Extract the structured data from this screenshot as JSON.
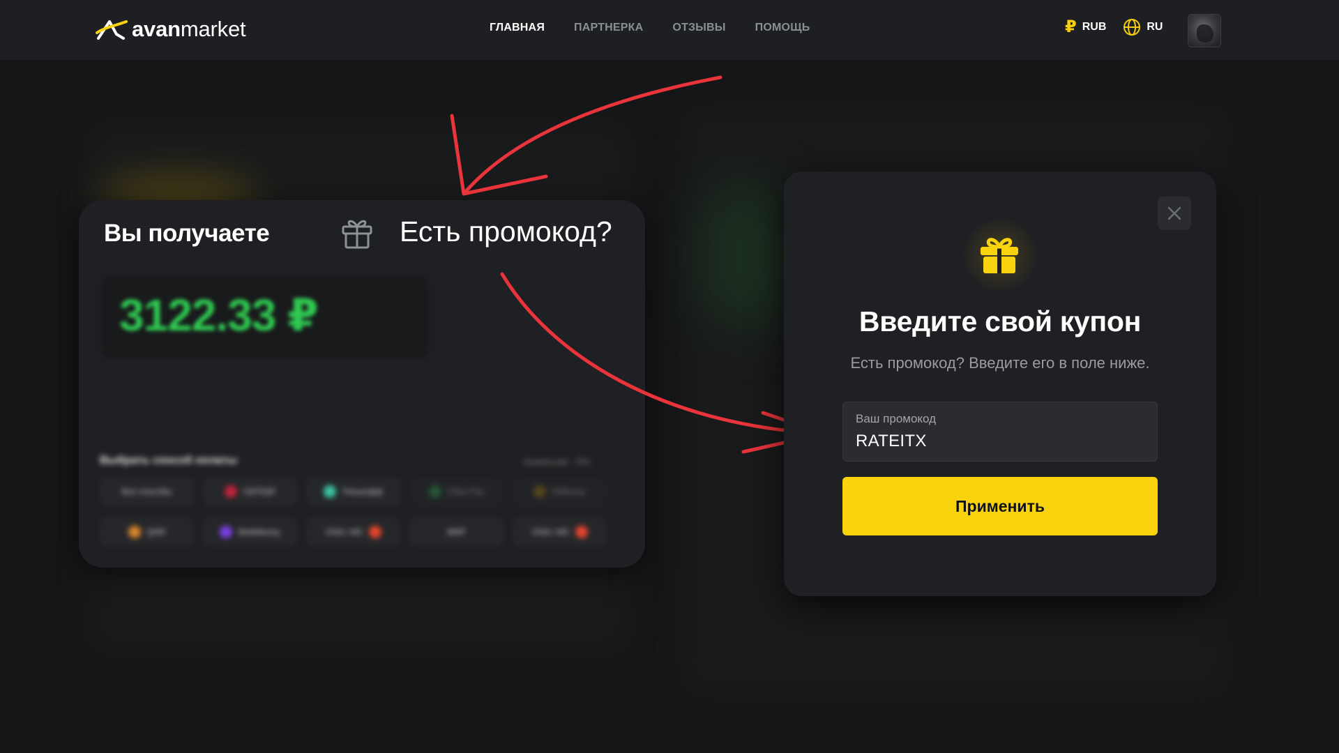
{
  "header": {
    "logo": {
      "bold": "avan",
      "thin": "market"
    },
    "nav": [
      {
        "label": "ГЛАВНАЯ",
        "active": true
      },
      {
        "label": "ПАРТНЕРКА",
        "active": false
      },
      {
        "label": "ОТЗЫВЫ",
        "active": false
      },
      {
        "label": "ПОМОЩЬ",
        "active": false
      }
    ],
    "currency": {
      "symbol": "₽",
      "label": "RUB"
    },
    "language": {
      "label": "RU"
    }
  },
  "left_card": {
    "title": "Вы получаете",
    "promo_link": "Есть промокод?",
    "amount": "3122.33 ₽",
    "payment": {
      "title": "Выбрать способ оплаты",
      "fee": "Комиссия · 0%",
      "methods_row1": [
        "Все способы",
        "СБП/QR",
        "Тинькофф",
        "Сбер Pay",
        "ЮMoney"
      ],
      "methods_row2": [
        "QIWI",
        "WebMoney",
        "VISA / MC",
        "МИР",
        "VISA / MC"
      ]
    }
  },
  "modal": {
    "title": "Введите свой купон",
    "subtitle": "Есть промокод? Введите его в поле ниже.",
    "input": {
      "label": "Ваш промокод",
      "value": "RATEITX"
    },
    "apply_label": "Применить"
  },
  "colors": {
    "accent": "#f9d30e",
    "background": "#151617",
    "card": "#1f2023",
    "amount_green": "#2fc951",
    "annotation_arrow": "#e8343a"
  }
}
